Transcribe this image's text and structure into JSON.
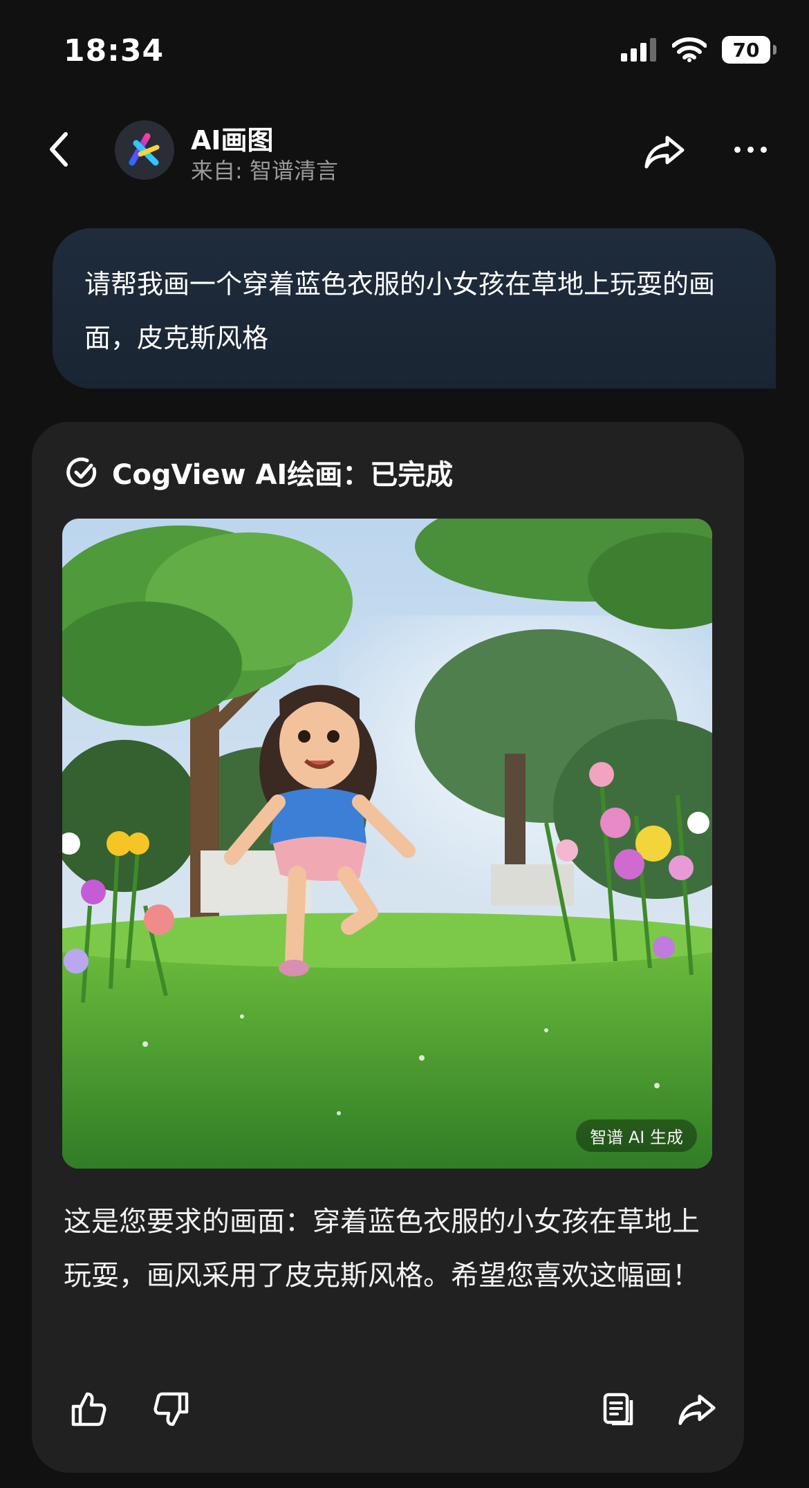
{
  "status_bar": {
    "time": "18:34",
    "battery": "70"
  },
  "header": {
    "title": "AI画图",
    "subtitle": "来自: 智谱清言"
  },
  "messages": {
    "user": "请帮我画一个穿着蓝色衣服的小女孩在草地上玩耍的画面，皮克斯风格",
    "ai": {
      "status": "CogView AI绘画：已完成",
      "image_watermark": "智谱 AI 生成",
      "reply": "这是您要求的画面：穿着蓝色衣服的小女孩在草地上玩耍，画风采用了皮克斯风格。希望您喜欢这幅画！"
    }
  },
  "icons": [
    "signal-icon",
    "wifi-icon",
    "battery-icon",
    "back-icon",
    "app-logo-icon",
    "share-icon",
    "more-icon",
    "check-circle-icon",
    "thumbs-up-icon",
    "thumbs-down-icon",
    "copy-icon"
  ],
  "colors": {
    "background": "#111111",
    "bubble": "#1f2c3c",
    "card": "#212121",
    "text_secondary": "#9a9a9a"
  }
}
